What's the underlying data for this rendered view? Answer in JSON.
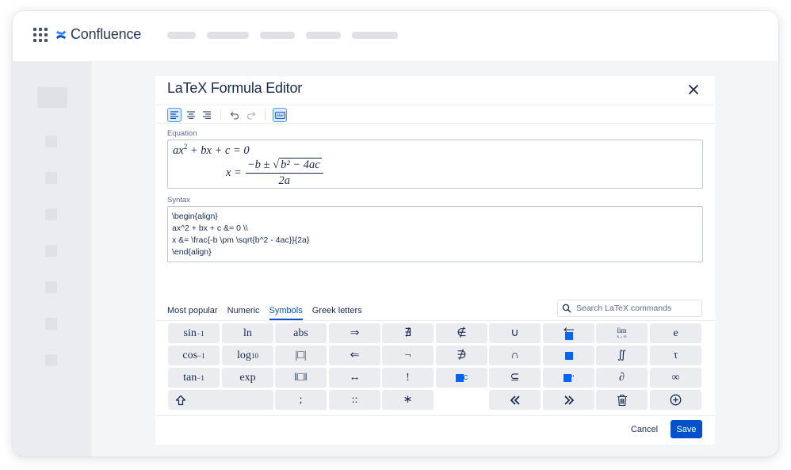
{
  "app": {
    "name": "Confluence",
    "brand_color": "#0052cc"
  },
  "dialog": {
    "title": "LaTeX Formula Editor",
    "toolbar": {
      "buttons": [
        "align-left-icon",
        "align-center-icon",
        "align-right-icon",
        "undo-icon",
        "redo-icon",
        "keyboard-icon"
      ],
      "active": [
        "align-left-icon",
        "keyboard-icon"
      ]
    },
    "equation_label": "Equation",
    "equation": {
      "line1": {
        "a": "a",
        "x": "x",
        "exp": "2",
        "rest": " + bx + c = 0"
      },
      "line2": {
        "lhs": "x =",
        "num_pre": "−b ± ",
        "sqrt": "√",
        "radicand": "b² − 4ac",
        "den": "2a"
      }
    },
    "syntax_label": "Syntax",
    "syntax_lines": [
      "\\begin{align}",
      "ax^2 + bx + c &= 0 \\\\",
      "x &= \\frac{-b \\pm \\sqrt{b^2 - 4ac}}{2a}",
      "\\end{align}"
    ],
    "tabs": [
      "Most popular",
      "Numeric",
      "Symbols",
      "Greek letters"
    ],
    "active_tab": "Symbols",
    "search": {
      "placeholder": "Search LaTeX commands",
      "value": ""
    },
    "keypad": {
      "row1": {
        "sin": "sin",
        "sin_exp": "−1",
        "ln": "ln",
        "abs": "abs",
        "implies": "⇒",
        "nexists": "∄",
        "notin": "∉",
        "cup": "∪",
        "lim": "lim",
        "lim_sub": "x→∞",
        "e": "e"
      },
      "row2": {
        "cos": "cos",
        "cos_exp": "−1",
        "log": "log",
        "log_sub": "10",
        "abs_box": "|□|",
        "impliedby": "⇐",
        "neg": "¬",
        "nni": "∌",
        "cap": "∩",
        "iint": "∬",
        "tau": "τ"
      },
      "row3": {
        "tan": "tan",
        "tan_exp": "−1",
        "exp": "exp",
        "norm_box": "‖□‖",
        "iff": "↔",
        "excl": "!",
        "complement": "C",
        "subseteq": "⊆",
        "dprime": "″",
        "partial": "∂",
        "infty": "∞"
      },
      "row4": {
        "semicolon": ";",
        "dcolon": "::",
        "ast": "∗"
      }
    },
    "cancel_label": "Cancel",
    "save_label": "Save"
  }
}
